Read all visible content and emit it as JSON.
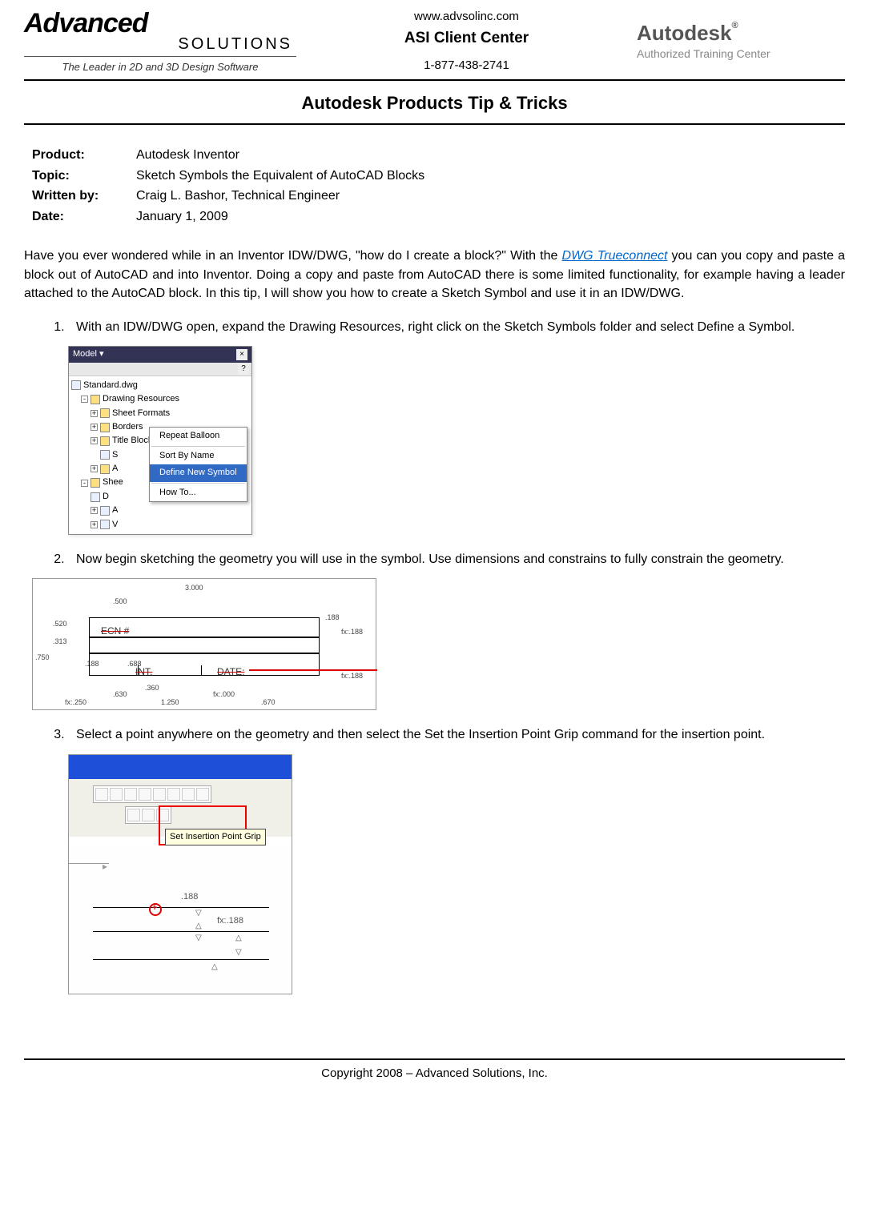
{
  "header": {
    "leftLogo": {
      "line1": "Advanced",
      "line2": "SOLUTIONS",
      "tagline": "The Leader in 2D and 3D Design Software"
    },
    "center": {
      "url": "www.advsolinc.com",
      "title": "ASI Client Center",
      "phone": "1-877-438-2741"
    },
    "rightLogo": {
      "name": "Autodesk",
      "reg": "®",
      "sub": "Authorized Training Center"
    }
  },
  "mainTitle": "Autodesk Products Tip & Tricks",
  "meta": {
    "productLabel": "Product:",
    "product": "Autodesk Inventor",
    "topicLabel": "Topic:",
    "topic": "Sketch Symbols the Equivalent of AutoCAD Blocks",
    "writtenByLabel": "Written by:",
    "writtenBy": "Craig L. Bashor, Technical Engineer",
    "dateLabel": "Date:",
    "date": "January 1, 2009"
  },
  "intro": {
    "part1": "Have you ever wondered while in an Inventor IDW/DWG, \"how do I create a block?\"  With the ",
    "link": "DWG Trueconnect",
    "part2": " you can you copy and paste a block out of AutoCAD and into Inventor.  Doing a copy and paste from AutoCAD there is some limited functionality, for example having a leader attached to the AutoCAD block.  In this tip, I will show you how to create a Sketch Symbol and use it in an IDW/DWG."
  },
  "steps": {
    "s1": "With an IDW/DWG open, expand the Drawing Resources, right click on the Sketch Symbols folder and select Define a Symbol.",
    "s2": "Now begin sketching the geometry you will use in the symbol.  Use dimensions and constrains to fully constrain the geometry.",
    "s3": "Select a point anywhere on the geometry and then select the Set the Insertion Point Grip command for the insertion point."
  },
  "fig1": {
    "title": "Model ▾",
    "help": "?",
    "root": "Standard.dwg",
    "node1": "Drawing Resources",
    "node2": "Sheet Formats",
    "node3": "Borders",
    "node4": "Title Blocks",
    "node5": "S",
    "node6": "A",
    "node7": "Shee",
    "node8": "D",
    "node9": "A",
    "node10": "V",
    "ctxRepeat": "Repeat Balloon",
    "ctxSort": "Sort By Name",
    "ctxDefine": "Define New Symbol",
    "ctxHow": "How To..."
  },
  "fig2": {
    "ecn": "ECN #",
    "int": "INT.",
    "date": "DATE:",
    "dim3000": "3.000",
    "dim500": ".500",
    "dim188a": ".188",
    "dimfx188a": "fx:.188",
    "dim750": ".750",
    "dim313": ".313",
    "dim520": ".520",
    "dim188b": ".188",
    "dim688": ".688",
    "dim630": ".630",
    "dim360": ".360",
    "dim250": "fx:.250",
    "dim1250": "1.250",
    "dimfx000": "fx:.000",
    "dim670": ".670",
    "dimfx188b": "fx:.188"
  },
  "fig3": {
    "tooltip": "Set Insertion Point Grip",
    "dim188": ".188",
    "dimfx188": "fx:.188"
  },
  "footer": "Copyright 2008 – Advanced Solutions, Inc."
}
